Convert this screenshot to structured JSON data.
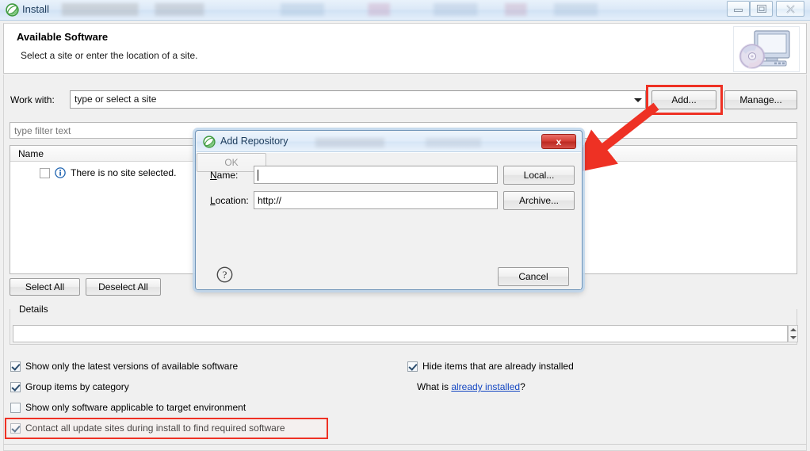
{
  "window": {
    "title": "Install",
    "icon": "eclipse-icon",
    "controls": {
      "minimize": "minimize-icon",
      "maximize": "maximize-icon",
      "close": "close-icon"
    }
  },
  "header": {
    "title": "Available Software",
    "subtitle": "Select a site or enter the location of a site.",
    "graphic": "monitor-with-disc-icon"
  },
  "work_with": {
    "label": "Work with:",
    "value": "",
    "placeholder": "type or select a site",
    "dropdown_icon": "chevron-down-icon"
  },
  "buttons": {
    "add": "Add...",
    "manage": "Manage...",
    "select_all": "Select All",
    "deselect_all": "Deselect All"
  },
  "filter": {
    "placeholder": "type filter text",
    "value": ""
  },
  "tree": {
    "column_name": "Name",
    "rows": [
      {
        "label": "There is no site selected.",
        "checked": false,
        "icon": "info-icon"
      }
    ]
  },
  "details": {
    "legend": "Details",
    "value": "",
    "spinner_up_icon": "spinner-up-icon",
    "spinner_down_icon": "spinner-down-icon"
  },
  "options": {
    "left": [
      {
        "id": "latest",
        "label": "Show only the latest versions of available software",
        "checked": true
      },
      {
        "id": "group",
        "label": "Group items by category",
        "checked": true
      },
      {
        "id": "target",
        "label": "Show only software applicable to target environment",
        "checked": false
      },
      {
        "id": "contact",
        "label": "Contact all update sites during install to find required software",
        "checked": true
      }
    ],
    "right": [
      {
        "id": "hide",
        "label": "Hide items that are already installed",
        "checked": true
      }
    ],
    "whatis": {
      "prefix": "What is ",
      "link": "already installed",
      "suffix": "?"
    }
  },
  "dialog": {
    "title": "Add Repository",
    "icon": "eclipse-icon",
    "close_label": "x",
    "fields": {
      "name": {
        "label": "Name:",
        "value": "",
        "mnemonic": "N"
      },
      "location": {
        "label": "Location:",
        "value": "http://",
        "mnemonic": "L"
      }
    },
    "buttons": {
      "local": "Local...",
      "archive": "Archive...",
      "ok": "OK",
      "cancel": "Cancel"
    },
    "help_icon": "help-question-icon"
  },
  "annotations": {
    "highlight_color": "#ee3124",
    "arrow": "red-arrow-pointing-to-dialog",
    "highlight_add_button": true,
    "highlight_contact_option": true
  }
}
